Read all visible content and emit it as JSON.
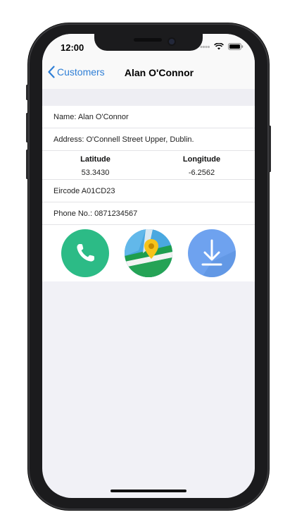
{
  "status": {
    "time": "12:00"
  },
  "nav": {
    "back_label": "Customers",
    "title": "Alan O'Connor"
  },
  "customer": {
    "name": "Name: Alan O'Connor",
    "address": "Address: O'Connell Street Upper, Dublin.",
    "latitude_label": "Latitude",
    "latitude": "53.3430",
    "longitude_label": "Longitude",
    "longitude": "-6.2562",
    "eircode": "Eircode A01CD23",
    "phone": "Phone No.: 0871234567"
  },
  "actions": [
    {
      "icon": "phone-icon",
      "color": "#2cbb86"
    },
    {
      "icon": "map-pin-icon",
      "color": "#4caf50"
    },
    {
      "icon": "download-icon",
      "color": "#6ea2ef"
    }
  ]
}
